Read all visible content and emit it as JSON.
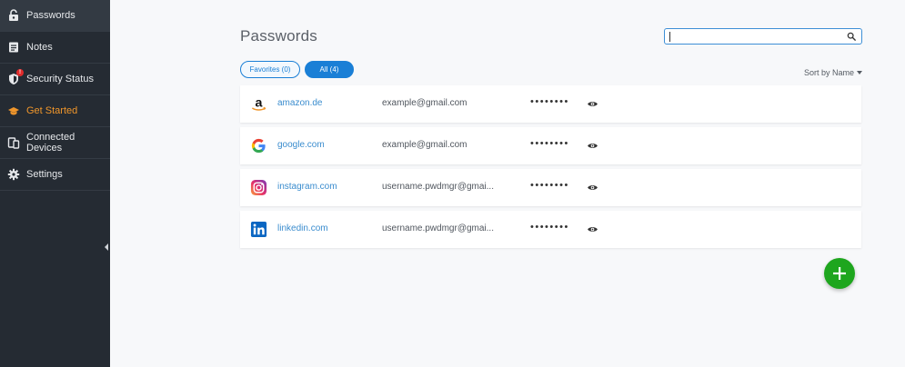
{
  "sidebar": {
    "items": [
      {
        "label": "Passwords",
        "icon": "key-icon",
        "active": true
      },
      {
        "label": "Notes",
        "icon": "note-icon"
      },
      {
        "label": "Security Status",
        "icon": "shield-icon",
        "alert": "!"
      },
      {
        "label": "Get Started",
        "icon": "graduation-cap-icon",
        "accent": true
      },
      {
        "label": "Connected Devices",
        "icon": "devices-icon"
      },
      {
        "label": "Settings",
        "icon": "gear-icon"
      }
    ]
  },
  "main": {
    "title": "Passwords",
    "search": {
      "value": "",
      "placeholder": "",
      "icon": "search-icon"
    },
    "filters": {
      "favorites": "Favorites (0)",
      "all": "All (4)"
    },
    "sort_label": "Sort by Name",
    "entries": [
      {
        "site": "amazon.de",
        "username": "example@gmail.com",
        "password_mask": "••••••••",
        "logo": "amazon-logo"
      },
      {
        "site": "google.com",
        "username": "example@gmail.com",
        "password_mask": "••••••••",
        "logo": "google-logo"
      },
      {
        "site": "instagram.com",
        "username": "username.pwdmgr@gmai...",
        "password_mask": "••••••••",
        "logo": "instagram-logo"
      },
      {
        "site": "linkedin.com",
        "username": "username.pwdmgr@gmai...",
        "password_mask": "••••••••",
        "logo": "linkedin-logo"
      }
    ],
    "add_button": "add-icon"
  },
  "colors": {
    "sidebar_bg": "#252b33",
    "accent_orange": "#f0962b",
    "primary_blue": "#1a7fd6",
    "link_blue": "#3a8cce",
    "fab_green": "#1ea61e",
    "alert_red": "#e02b2b"
  }
}
